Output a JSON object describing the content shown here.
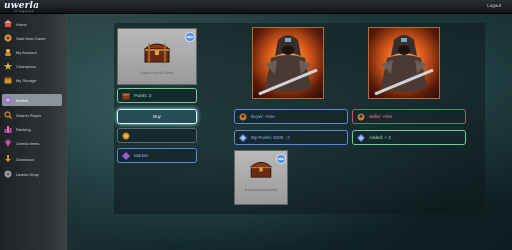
{
  "topbar": {
    "logo": "uwerla",
    "logo_sub": "of legends",
    "logout": "Logout"
  },
  "sidebar": {
    "items": [
      {
        "label": "Home",
        "icon": "home-icon",
        "color": "#d9534f"
      },
      {
        "label": "Start New Game",
        "icon": "game-icon",
        "color": "#e39b3a"
      },
      {
        "label": "My Account",
        "icon": "account-icon",
        "color": "#e3b23a"
      },
      {
        "label": "Champions",
        "icon": "champions-icon",
        "color": "#e3b23a"
      },
      {
        "label": "My Storage",
        "icon": "storage-icon",
        "color": "#d18f2e"
      },
      {
        "label": "Market",
        "icon": "market-icon",
        "color": "#9a5bd8",
        "active": true
      },
      {
        "label": "Search Player",
        "icon": "search-player-icon",
        "color": "#d18f2e"
      },
      {
        "label": "Ranking",
        "icon": "ranking-icon",
        "color": "#c24aa8"
      },
      {
        "label": "Uwerla Items",
        "icon": "items-icon",
        "color": "#c24aa8"
      },
      {
        "label": "Download",
        "icon": "download-icon",
        "color": "#d18f2e"
      },
      {
        "label": "Uwerla Shop",
        "icon": "shop-icon",
        "color": "#9aa4ad"
      }
    ]
  },
  "market": {
    "item_card_label": "BasicUwerlaChest",
    "badge": "NEW",
    "points_label": "Points: 2",
    "buy_label": "Buy",
    "market_label": "Market",
    "buyer_label": "Buyer: Artre",
    "seller_label": "Seller: Artre",
    "my_points_label": "My Points: 9100 - 2",
    "added_label": "Added: + 2",
    "offer_card_label": "BasicUwerlaChest"
  }
}
